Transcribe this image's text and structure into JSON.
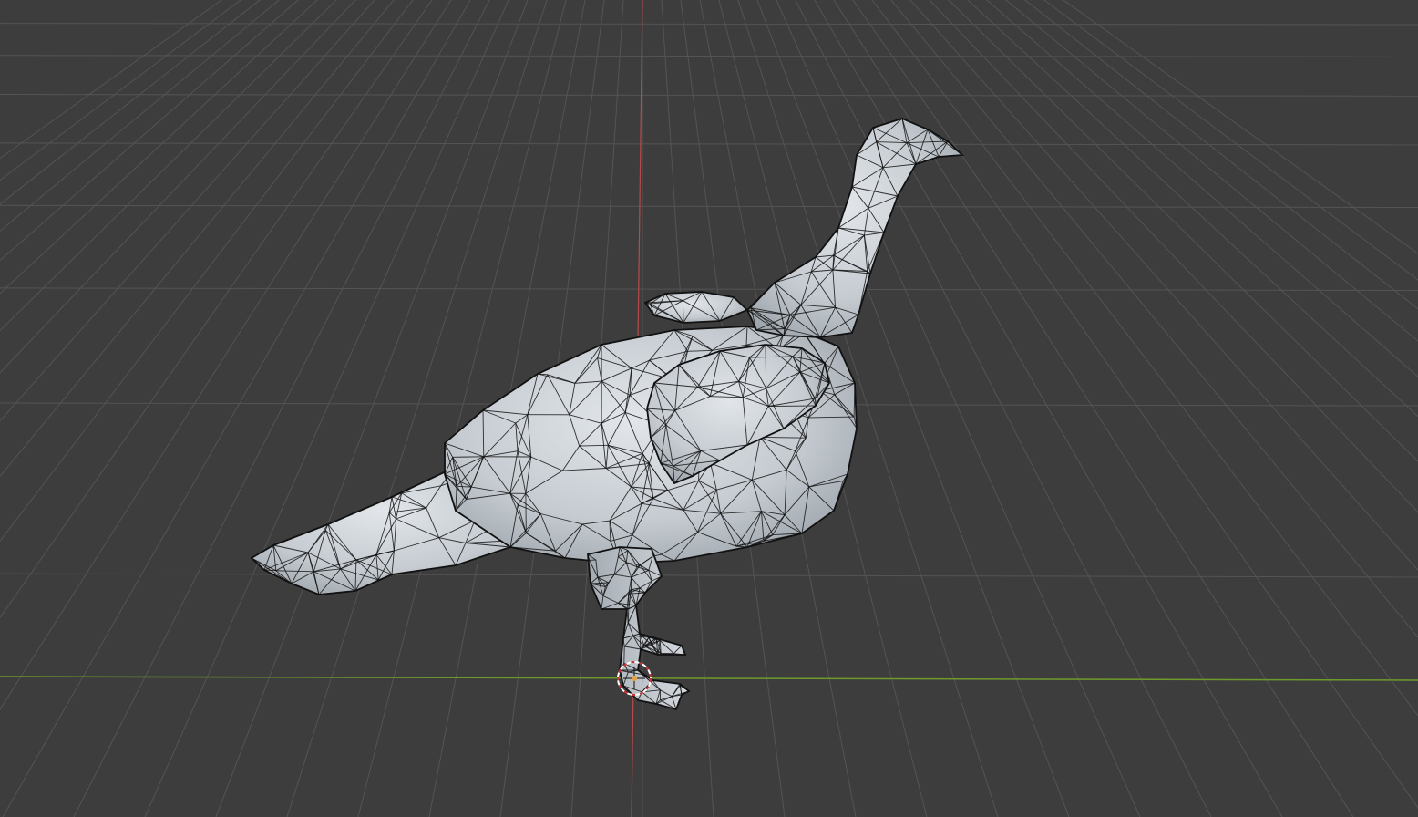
{
  "viewport": {
    "background_color": "#3d3d3d",
    "grid_color": "#545454",
    "x_axis_color": "#6e9a2c",
    "y_axis_color": "#b84a4a",
    "mesh_fill_color": "#c9ced3",
    "mesh_wire_color": "#111111",
    "origin_marker_color": "#e8e8e8"
  },
  "scene": {
    "object": "bird-mesh",
    "shading": "solid",
    "overlay": "wireframe"
  },
  "icons": {
    "cursor": "3d-cursor-icon",
    "origin": "object-origin-icon"
  }
}
